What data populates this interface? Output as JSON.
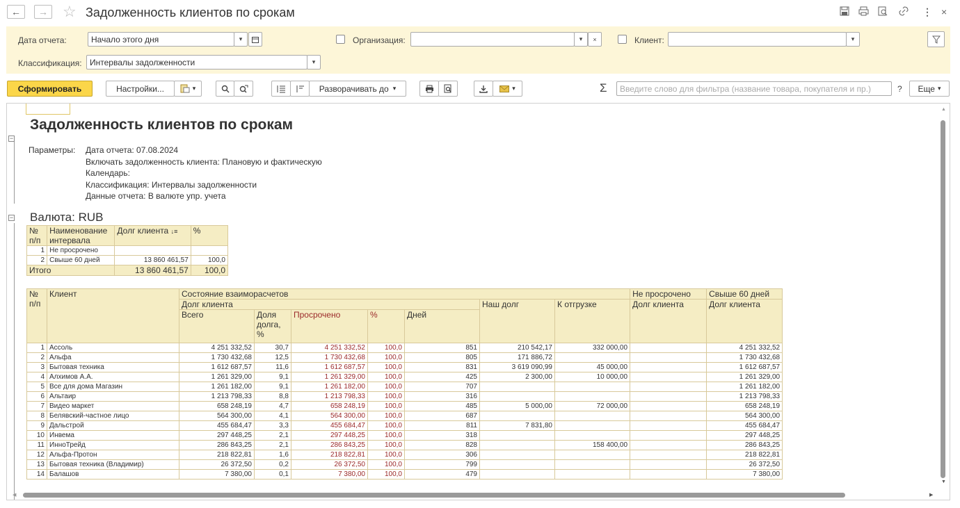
{
  "window": {
    "title": "Задолженность клиентов по срокам",
    "back_icon": "←",
    "forward_icon": "→",
    "star_icon": "☆",
    "more_icon": "⋮",
    "close_icon": "×"
  },
  "filters": {
    "report_date_label": "Дата отчета:",
    "report_date_value": "Начало этого дня",
    "organization_label": "Организация:",
    "organization_value": "",
    "client_label": "Клиент:",
    "client_value": "",
    "classification_label": "Классификация:",
    "classification_value": "Интервалы задолженности"
  },
  "toolbar": {
    "generate": "Сформировать",
    "settings": "Настройки...",
    "expand_to": "Разворачивать до",
    "sigma": "Σ",
    "filter_placeholder": "Введите слово для фильтра (название товара, покупателя и пр.)",
    "help": "?",
    "more": "Еще"
  },
  "report": {
    "title": "Задолженность клиентов по срокам",
    "params_label": "Параметры:",
    "params": [
      "Дата отчета: 07.08.2024",
      "Включать задолженность клиента: Плановую и фактическую",
      "Календарь:",
      "Классификация: Интервалы задолженности",
      "Данные отчета: В валюте упр. учета"
    ],
    "currency": "Валюта: RUB",
    "summary": {
      "headers": [
        "№ п/п",
        "Наименование интервала",
        "Долг клиента",
        "%"
      ],
      "rows": [
        {
          "n": "1",
          "name": "Не просрочено",
          "debt": "",
          "pct": ""
        },
        {
          "n": "2",
          "name": "Свыше 60 дней",
          "debt": "13 860 461,57",
          "pct": "100,0"
        }
      ],
      "total_label": "Итого",
      "total_debt": "13 860 461,57",
      "total_pct": "100,0"
    },
    "main": {
      "h_num": "№ п/п",
      "h_client": "Клиент",
      "h_state": "Состояние взаиморасчетов",
      "h_debt": "Долг клиента",
      "h_total": "Всего",
      "h_share": "Доля долга, %",
      "h_overdue": "Просрочено",
      "h_pct": "%",
      "h_days": "Дней",
      "h_our_debt": "Наш долг",
      "h_to_ship": "К отгрузке",
      "h_not_overdue": "Не просрочено",
      "h_not_overdue_debt": "Долг клиента",
      "h_over60": "Свыше 60 дней",
      "h_over60_debt": "Долг клиента",
      "rows": [
        {
          "n": "1",
          "client": "Ассоль",
          "total": "4 251 332,52",
          "share": "30,7",
          "overdue": "4 251 332,52",
          "pct": "100,0",
          "days": "851",
          "our": "210 542,17",
          "ship": "332 000,00",
          "nover": "",
          "over60": "4 251 332,52"
        },
        {
          "n": "2",
          "client": "Альфа",
          "total": "1 730 432,68",
          "share": "12,5",
          "overdue": "1 730 432,68",
          "pct": "100,0",
          "days": "805",
          "our": "171 886,72",
          "ship": "",
          "nover": "",
          "over60": "1 730 432,68"
        },
        {
          "n": "3",
          "client": "Бытовая техника",
          "total": "1 612 687,57",
          "share": "11,6",
          "overdue": "1 612 687,57",
          "pct": "100,0",
          "days": "831",
          "our": "3 619 090,99",
          "ship": "45 000,00",
          "nover": "",
          "over60": "1 612 687,57"
        },
        {
          "n": "4",
          "client": "Алхимов А.А.",
          "total": "1 261 329,00",
          "share": "9,1",
          "overdue": "1 261 329,00",
          "pct": "100,0",
          "days": "425",
          "our": "2 300,00",
          "ship": "10 000,00",
          "nover": "",
          "over60": "1 261 329,00"
        },
        {
          "n": "5",
          "client": "Все для дома Магазин",
          "total": "1 261 182,00",
          "share": "9,1",
          "overdue": "1 261 182,00",
          "pct": "100,0",
          "days": "707",
          "our": "",
          "ship": "",
          "nover": "",
          "over60": "1 261 182,00"
        },
        {
          "n": "6",
          "client": "Альтаир",
          "total": "1 213 798,33",
          "share": "8,8",
          "overdue": "1 213 798,33",
          "pct": "100,0",
          "days": "316",
          "our": "",
          "ship": "",
          "nover": "",
          "over60": "1 213 798,33"
        },
        {
          "n": "7",
          "client": "Видео маркет",
          "total": "658 248,19",
          "share": "4,7",
          "overdue": "658 248,19",
          "pct": "100,0",
          "days": "485",
          "our": "5 000,00",
          "ship": "72 000,00",
          "nover": "",
          "over60": "658 248,19"
        },
        {
          "n": "8",
          "client": "Белявский-частное лицо",
          "total": "564 300,00",
          "share": "4,1",
          "overdue": "564 300,00",
          "pct": "100,0",
          "days": "687",
          "our": "",
          "ship": "",
          "nover": "",
          "over60": "564 300,00"
        },
        {
          "n": "9",
          "client": "Дальстрой",
          "total": "455 684,47",
          "share": "3,3",
          "overdue": "455 684,47",
          "pct": "100,0",
          "days": "811",
          "our": "7 831,80",
          "ship": "",
          "nover": "",
          "over60": "455 684,47"
        },
        {
          "n": "10",
          "client": "Инвема",
          "total": "297 448,25",
          "share": "2,1",
          "overdue": "297 448,25",
          "pct": "100,0",
          "days": "318",
          "our": "",
          "ship": "",
          "nover": "",
          "over60": "297 448,25"
        },
        {
          "n": "11",
          "client": "ИнноТрейд",
          "total": "286 843,25",
          "share": "2,1",
          "overdue": "286 843,25",
          "pct": "100,0",
          "days": "828",
          "our": "",
          "ship": "158 400,00",
          "nover": "",
          "over60": "286 843,25"
        },
        {
          "n": "12",
          "client": "Альфа-Протон",
          "total": "218 822,81",
          "share": "1,6",
          "overdue": "218 822,81",
          "pct": "100,0",
          "days": "306",
          "our": "",
          "ship": "",
          "nover": "",
          "over60": "218 822,81"
        },
        {
          "n": "13",
          "client": "Бытовая техника (Владимир)",
          "total": "26 372,50",
          "share": "0,2",
          "overdue": "26 372,50",
          "pct": "100,0",
          "days": "799",
          "our": "",
          "ship": "",
          "nover": "",
          "over60": "26 372,50"
        },
        {
          "n": "14",
          "client": "Балашов",
          "total": "7 380,00",
          "share": "0,1",
          "overdue": "7 380,00",
          "pct": "100,0",
          "days": "479",
          "our": "",
          "ship": "",
          "nover": "",
          "over60": "7 380,00"
        }
      ]
    }
  }
}
